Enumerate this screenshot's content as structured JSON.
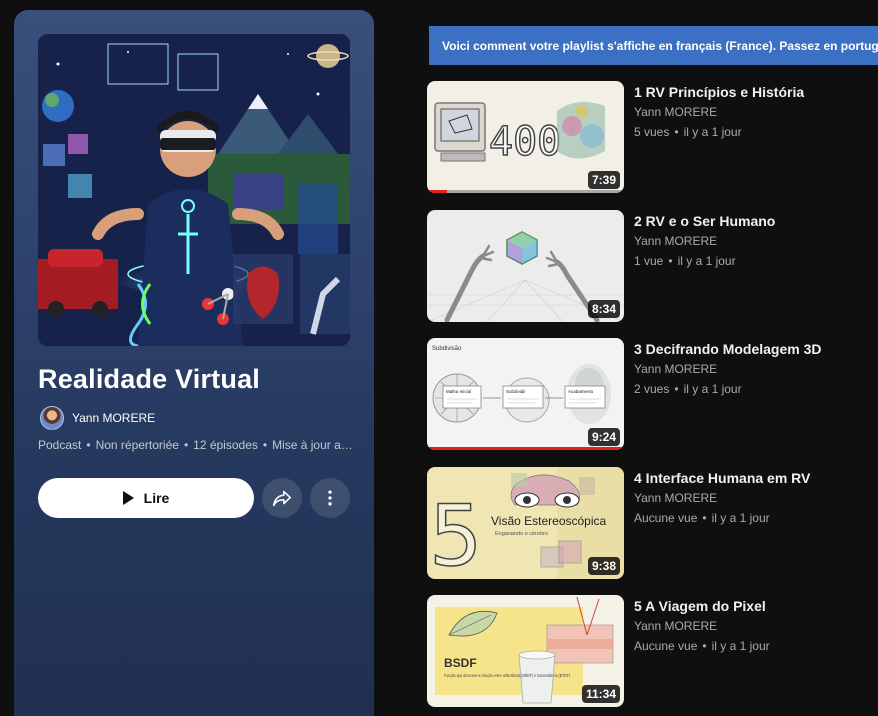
{
  "playlist": {
    "title": "Realidade Virtual",
    "owner": "Yann MORERE",
    "meta": [
      "Podcast",
      "Non répertoriée",
      "12 épisodes",
      "Mise à jour aujourd'hui"
    ],
    "play_label": "Lire"
  },
  "banner": {
    "text": "Voici comment votre playlist s'affiche en français (France). Passez en portugais"
  },
  "videos": [
    {
      "title": "1 RV  Princípios e História",
      "channel": "Yann MORERE",
      "views": "5 vues",
      "age": "il y a 1 jour",
      "duration": "7:39",
      "watched": 0.1
    },
    {
      "title": "2 RV e o Ser Humano",
      "channel": "Yann MORERE",
      "views": "1 vue",
      "age": "il y a 1 jour",
      "duration": "8:34",
      "watched": 0
    },
    {
      "title": "3 Decifrando Modelagem 3D",
      "channel": "Yann MORERE",
      "views": "2 vues",
      "age": "il y a 1 jour",
      "duration": "9:24",
      "watched": 1.0
    },
    {
      "title": "4 Interface Humana em RV",
      "channel": "Yann MORERE",
      "views": "Aucune vue",
      "age": "il y a 1 jour",
      "duration": "9:38",
      "watched": 0
    },
    {
      "title": "5 A Viagem do Pixel",
      "channel": "Yann MORERE",
      "views": "Aucune vue",
      "age": "il y a 1 jour",
      "duration": "11:34",
      "watched": 0
    }
  ],
  "thumb_text": {
    "t1": "400",
    "t3_header": "Subdivisão",
    "t3_labels": [
      "Malha Inicial",
      "Subdividir",
      "Acabamento"
    ],
    "t4_number": "5",
    "t4_title": "Visão Estereoscópica",
    "t4_sub": "Enganando o cérebro",
    "t5_title": "BSDF",
    "t5_sub": "Função que descreve a relação entre reflectância (BRDF) e transmitância (BTDF)"
  }
}
